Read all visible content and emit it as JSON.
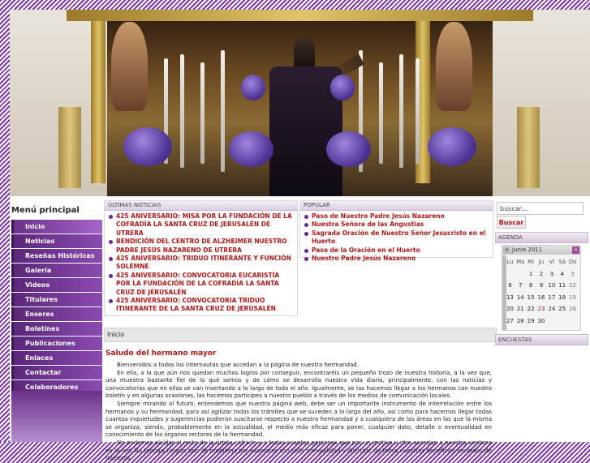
{
  "colors": {
    "accent": "#6a2a8c",
    "link_red": "#b01818",
    "menu_purple": "#5b2679"
  },
  "menu": {
    "title": "Menú principal",
    "items": [
      "Inicio",
      "Noticias",
      "Reseñas Históricas",
      "Galería",
      "Videos",
      "Titulares",
      "Enseres",
      "Boletines",
      "Publicaciones",
      "Enlaces",
      "Contactar",
      "Colaboradores"
    ]
  },
  "news": {
    "heading": "ÚLTIMAS NOTICIAS",
    "items": [
      "425 ANIVERSARIO: MISA POR LA FUNDACIÓN DE LA COFRADÍA LA SANTA CRUZ DE JERUSALÉN DE UTRERA",
      "BENDICIÓN DEL CENTRO DE ALZHEIMER NUESTRO PADRE JESÚS NAZARENO DE UTRERA",
      "425 ANIVERSARIO: TRIDUO ITINERANTE Y FUNCIÓN SOLEMNE",
      "425 ANIVERSARIO: CONVOCATORIA EUCARISTÍA POR LA FUNDACIÓN DE LA COFRADÍA LA SANTA CRUZ DE JERUSALÉN",
      "425 ANIVERSARIO: CONVOCATORIA TRIDUO ITINERANTE DE LA SANTA CRUZ DE JERUSALÉN"
    ]
  },
  "popular": {
    "heading": "POPULAR",
    "items": [
      "Paso de Nuestro Padre Jesús Nazareno",
      "Nuestra Señora de las Angustias",
      "Sagrada Oración de Nuestro Señor Jesucristo en el Huerto",
      "Paso de la Oración en el Huerto",
      "Nuestro Padre Jesús Nazareno"
    ]
  },
  "breadcrumb": "Inicio",
  "article": {
    "title": "Saludo del hermano mayor",
    "paragraphs": [
      "Bienvenidos a todos los internautas que accedan a la página de nuestra hermandad.",
      "En ella, a la que aún nos quedan muchos logros por conseguir, encontraréis un pequeño trozo de nuestra historia, a la vez que, una muestra bastante fiel de lo qué somos y de cómo se desarrolla nuestra vida diaria, principalmente, con las noticias y convocatorias que en ellas se van insertando a lo largo de todo el año. Igualmente, se las hacemos llegar a los hermanos con nuestro boletín y en algunas ocasiones, las hacemos participes a nuestro pueblo a través de los medios de comunicación locales.",
      "Siempre mirando al futuro, entendemos que nuestra página web, debe ser un importante instrumento de interrelación entre los hermanos y su hermandad, para así agilizar todos los trámites que se suceden a lo largo del año, así como para hacernos llegar todas cuantas inquietudes y sugerencias pudieran suscitarse respecto a nuestra hermandad y a cualquiera de las áreas en las que la misma se organiza; siendo, probablemente en la actualidad, el medio más eficaz para poner, cualquier dato, detalle o eventualidad en conocimiento de los órganos rectores de la hermandad.",
      "No podemos olvidar el resto de la órbita cofrade y a todas cuantas personas que por un motivo u otro accedan a nuestra ventana en la red. No tengáis ningún tipo de problema por asomaros con toda tranquilidad y disfrutar de todos nuestros beneficios recibidos de nuestros"
    ]
  },
  "search": {
    "placeholder": "buscar...",
    "button": "Buscar"
  },
  "agenda": {
    "heading": "AGENDA",
    "month": "Junio 2011",
    "prev": "«",
    "next": "»",
    "weekdays": [
      "Lu",
      "Ma",
      "Mi",
      "Ju",
      "Vi",
      "Sá",
      "Do"
    ],
    "today": "23",
    "cells": [
      "",
      "",
      "1",
      "2",
      "3",
      "4",
      "5",
      "6",
      "7",
      "8",
      "9",
      "10",
      "11",
      "12",
      "13",
      "14",
      "15",
      "16",
      "17",
      "18",
      "19",
      "20",
      "21",
      "22",
      "23",
      "24",
      "25",
      "26",
      "27",
      "28",
      "29",
      "30",
      "",
      "",
      ""
    ]
  },
  "encuestas": {
    "heading": "ENCUESTAS"
  }
}
